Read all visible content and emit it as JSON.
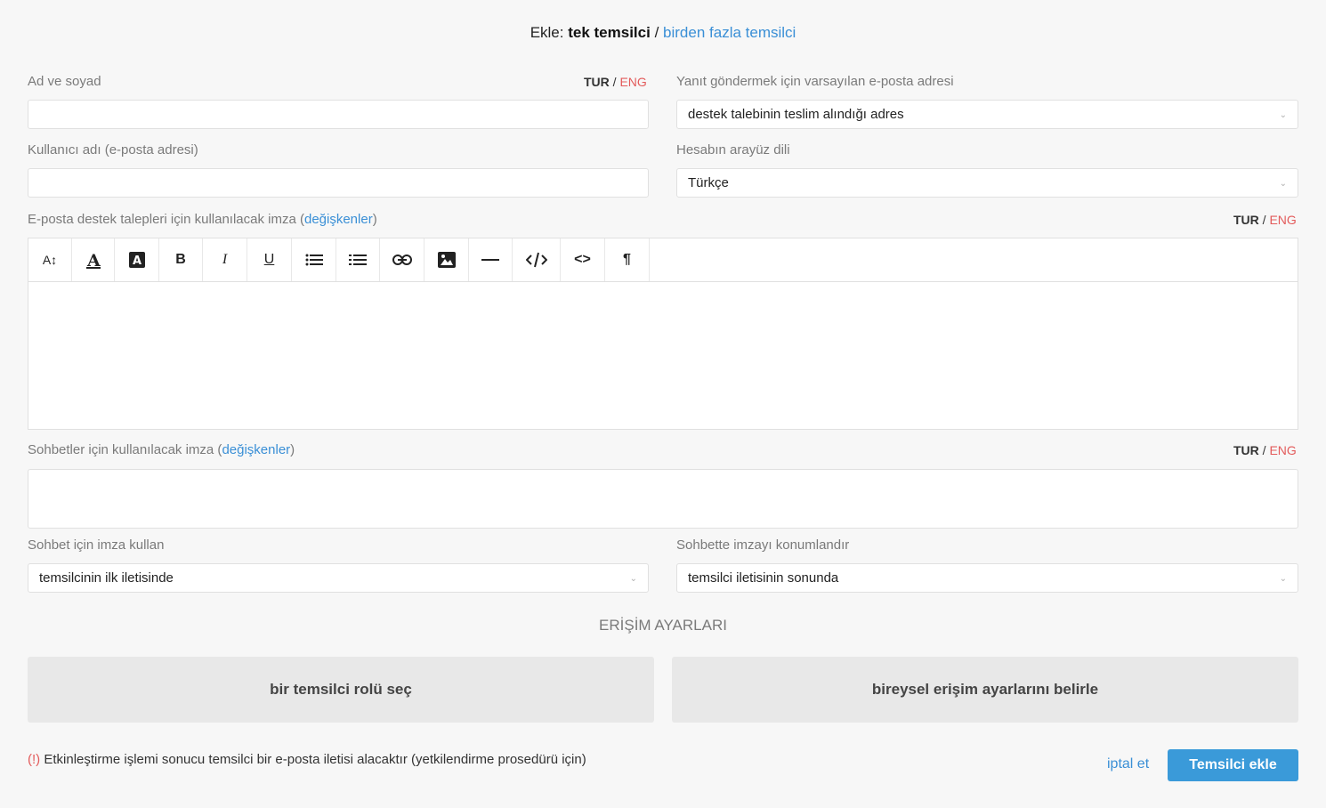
{
  "header": {
    "prefix": "Ekle:",
    "current": "tek temsilci",
    "separator": "/",
    "alternate": "birden fazla temsilci"
  },
  "lang_switch": {
    "primary": "TUR",
    "separator": "/",
    "secondary": "ENG"
  },
  "fields": {
    "name_label": "Ad ve soyad",
    "reply_email_label": "Yanıt göndermek için varsayılan e-posta adresi",
    "reply_email_value": "destek talebinin teslim alındığı adres",
    "username_label": "Kullanıcı adı (e-posta adresi)",
    "ui_lang_label": "Hesabın arayüz dili",
    "ui_lang_value": "Türkçe",
    "email_signature_label": "E-posta destek talepleri için kullanılacak imza (",
    "chat_signature_label": "Sohbetler için kullanılacak imza (",
    "variables_link": "değişkenler",
    "close_paren": ")",
    "use_signature_label": "Sohbet için imza kullan",
    "use_signature_value": "temsilcinin ilk iletisinde",
    "signature_position_label": "Sohbette imzayı konumlandır",
    "signature_position_value": "temsilci iletisinin sonunda"
  },
  "toolbar": {
    "font_size": "A↕",
    "bold": "B",
    "italic": "I",
    "underline": "U",
    "paragraph": "¶",
    "code": "<>"
  },
  "access": {
    "title": "ERİŞİM AYARLARI",
    "role_button": "bir temsilci rolü seç",
    "individual_button": "bireysel erişim ayarlarını belirle"
  },
  "footer": {
    "notice_mark": "(!)",
    "notice_text": "Etkinleştirme işlemi sonucu temsilci bir e-posta iletisi alacaktır (yetkilendirme prosedürü için)",
    "cancel": "iptal et",
    "submit": "Temsilci ekle"
  },
  "icons": {
    "caret": "chevron-down-icon"
  },
  "colors": {
    "link": "#3a8fd6",
    "alt_lang": "#e35b5b",
    "primary_button": "#3a9ad9"
  }
}
